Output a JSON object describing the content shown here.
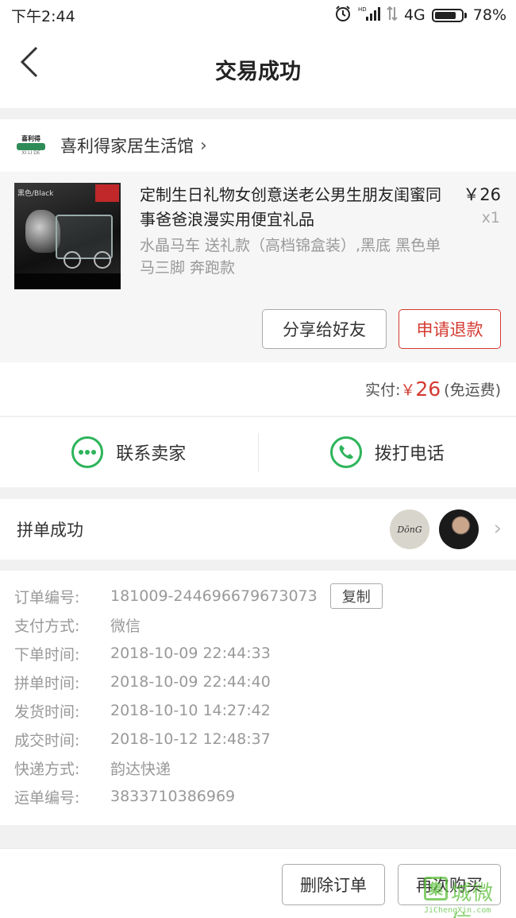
{
  "status_bar": {
    "time": "下午2:44",
    "network": "4G",
    "battery": "78%",
    "icons": [
      "alarm-icon",
      "signal-hd-icon",
      "data-arrows-icon",
      "battery-icon"
    ]
  },
  "header": {
    "title": "交易成功",
    "back_icon": "chevron-left-icon"
  },
  "shop": {
    "name": "喜利得家居生活馆",
    "logo_text": "喜利得",
    "logo_sub": "XI LI DE"
  },
  "product": {
    "image_tag": "黑色/Black",
    "title": "定制生日礼物女创意送老公男生朋友闺蜜同事爸爸浪漫实用便宜礼品",
    "spec": "水晶马车 送礼款（高档锦盒装）,黑底 黑色单马三脚 奔跑款",
    "price": "￥26",
    "quantity": "x1"
  },
  "actions": {
    "share": "分享给好友",
    "refund": "申请退款"
  },
  "payment": {
    "label": "实付:",
    "currency": "￥",
    "amount": "26",
    "note": "(免运费)"
  },
  "contact": {
    "seller": "联系卖家",
    "call": "拨打电话"
  },
  "group": {
    "label": "拼单成功",
    "avatar1_text": "DōnG"
  },
  "details": {
    "rows": [
      {
        "label": "订单编号:",
        "value": "181009-244696679673073"
      },
      {
        "label": "支付方式:",
        "value": "微信"
      },
      {
        "label": "下单时间:",
        "value": "2018-10-09 22:44:33"
      },
      {
        "label": "拼单时间:",
        "value": "2018-10-09 22:44:40"
      },
      {
        "label": "发货时间:",
        "value": "2018-10-10 14:27:42"
      },
      {
        "label": "成交时间:",
        "value": "2018-10-12 12:48:37"
      },
      {
        "label": "快递方式:",
        "value": "韵达快递"
      },
      {
        "label": "运单编号:",
        "value": "3833710386969"
      }
    ],
    "copy": "复制"
  },
  "bottom": {
    "delete": "删除订单",
    "rebuy": "再次购买"
  },
  "watermark": {
    "mark": "集",
    "text": "城微信",
    "url": "JiChengXin.com"
  },
  "colors": {
    "accent_red": "#d33a31",
    "wechat_green": "#2db45a"
  }
}
